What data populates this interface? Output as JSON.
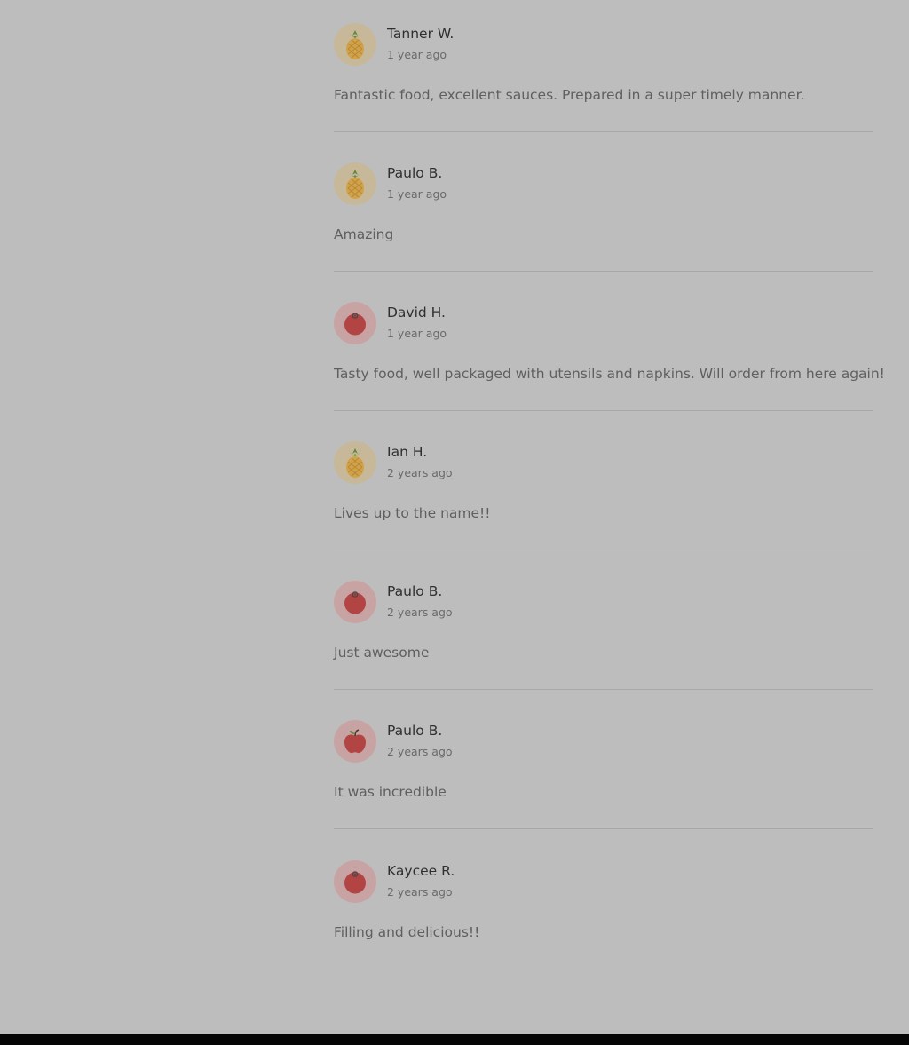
{
  "reviews": [
    {
      "name": "Tanner W.",
      "date": "1 year ago",
      "text": "Fantastic food, excellent sauces. Prepared in a super timely manner.",
      "avatar_icon": "pineapple-icon",
      "avatar_bg": "#c8b89a"
    },
    {
      "name": "Paulo B.",
      "date": "1 year ago",
      "text": "Amazing",
      "avatar_icon": "pineapple-icon",
      "avatar_bg": "#c8b89a"
    },
    {
      "name": "David H.",
      "date": "1 year ago",
      "text": "Tasty food, well packaged with utensils and napkins. Will order from here again!",
      "avatar_icon": "tomato-icon",
      "avatar_bg": "#c8a3a3"
    },
    {
      "name": "Ian H.",
      "date": "2 years ago",
      "text": "Lives up to the name!!",
      "avatar_icon": "pineapple-icon",
      "avatar_bg": "#c8b89a"
    },
    {
      "name": "Paulo B.",
      "date": "2 years ago",
      "text": "Just awesome",
      "avatar_icon": "tomato-icon",
      "avatar_bg": "#c8a3a3"
    },
    {
      "name": "Paulo B.",
      "date": "2 years ago",
      "text": "It was incredible",
      "avatar_icon": "apple-icon",
      "avatar_bg": "#c8a3a3"
    },
    {
      "name": "Kaycee R.",
      "date": "2 years ago",
      "text": "Filling and delicious!!",
      "avatar_icon": "tomato-icon",
      "avatar_bg": "#c8a3a3"
    }
  ],
  "colors": {
    "overlay_bg": "#bdbdbd",
    "name_text": "#2f2f2f",
    "body_text": "#5f5f5f",
    "footer": "#050505"
  }
}
